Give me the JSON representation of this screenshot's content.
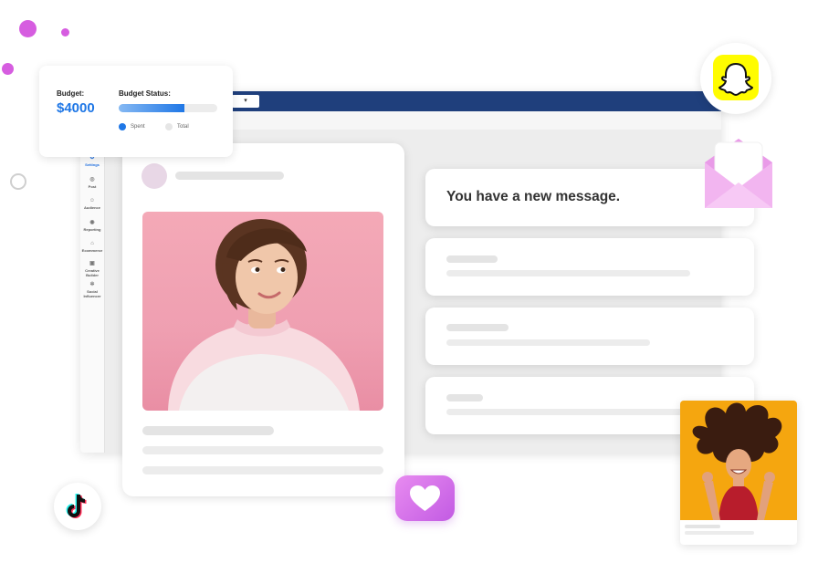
{
  "budget": {
    "label": "Budget:",
    "amount": "$4000",
    "status_label": "Budget Status:",
    "progress_fraction": 0.67,
    "legend_spent": "Spent",
    "legend_total": "Total",
    "spent_color": "#1f77e6",
    "total_color": "#e6e6e6"
  },
  "app": {
    "header_color": "#1f3f7c",
    "dropdown_glyph": "▾",
    "sidebar": [
      {
        "label": "Settings",
        "icon": "gear-icon",
        "glyph": "⚙",
        "active": true
      },
      {
        "label": "Post",
        "icon": "post-icon",
        "glyph": "◎",
        "active": false
      },
      {
        "label": "Audience",
        "icon": "audience-icon",
        "glyph": "☺",
        "active": false
      },
      {
        "label": "Reporting",
        "icon": "reporting-icon",
        "glyph": "◉",
        "active": false
      },
      {
        "label": "Ecommerce",
        "icon": "cart-icon",
        "glyph": "⌂",
        "active": false
      },
      {
        "label": "Creative Builder",
        "icon": "image-icon",
        "glyph": "▣",
        "active": false
      },
      {
        "label": "Social Influencer",
        "icon": "influencer-icon",
        "glyph": "✲",
        "active": false
      }
    ]
  },
  "notification": {
    "message": "You have a new message."
  },
  "icons": {
    "snapchat": "snapchat-icon",
    "tiktok": "tiktok-icon",
    "heart": "heart-icon",
    "envelope": "envelope-icon",
    "heart_glyph": "♥",
    "tiktok_glyph": "♪"
  },
  "colors": {
    "accent_blue": "#1f77e6",
    "snapchat_yellow": "#fffc00",
    "heart_purple": "#d070ea",
    "photo_pink": "#f1a4b4",
    "influencer_orange": "#f5a60f"
  }
}
